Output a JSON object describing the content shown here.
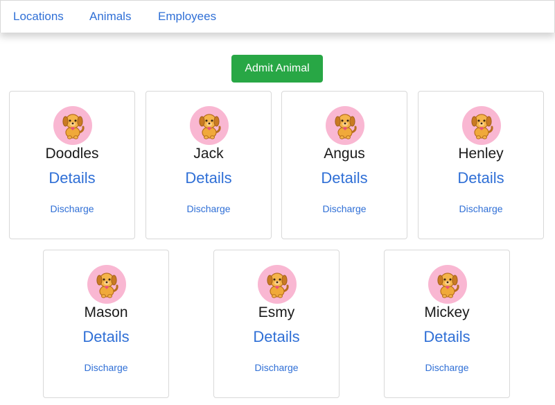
{
  "nav": {
    "locations": "Locations",
    "animals": "Animals",
    "employees": "Employees"
  },
  "admit_button": "Admit Animal",
  "animals": [
    {
      "name": "Doodles",
      "details": "Details",
      "discharge": "Discharge"
    },
    {
      "name": "Jack",
      "details": "Details",
      "discharge": "Discharge"
    },
    {
      "name": "Angus",
      "details": "Details",
      "discharge": "Discharge"
    },
    {
      "name": "Henley",
      "details": "Details",
      "discharge": "Discharge"
    },
    {
      "name": "Mason",
      "details": "Details",
      "discharge": "Discharge"
    },
    {
      "name": "Esmy",
      "details": "Details",
      "discharge": "Discharge"
    },
    {
      "name": "Mickey",
      "details": "Details",
      "discharge": "Discharge"
    }
  ],
  "avatar_icon": "puppy-icon",
  "colors": {
    "link": "#2f6fd6",
    "admit_button": "#28a745",
    "avatar_bg": "#f9b7d2"
  }
}
